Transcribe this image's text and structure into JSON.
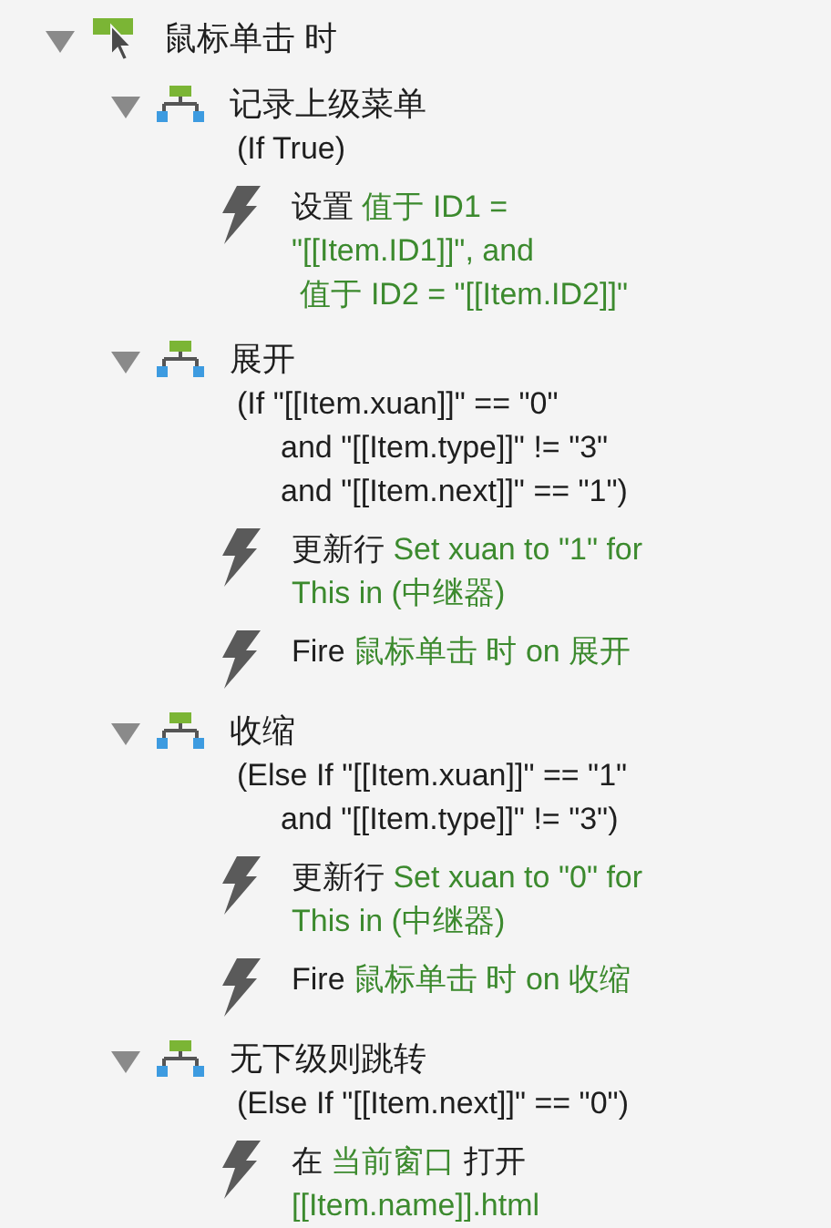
{
  "event": {
    "title": "鼠标单击 时",
    "expanded": true,
    "cases": [
      {
        "title": "记录上级菜单",
        "expanded": true,
        "condition": [
          "(If True)"
        ],
        "actions": [
          {
            "parts": [
              {
                "kind": "verb",
                "text": "设置"
              },
              {
                "kind": "target",
                "text": "值于 ID1 =\n\"[[Item.ID1]]\", and\n 值于 ID2 = \"[[Item.ID2]]\""
              }
            ]
          }
        ]
      },
      {
        "title": "展开",
        "expanded": true,
        "condition": [
          "(If \"[[Item.xuan]]\" == \"0\"",
          "and \"[[Item.type]]\" != \"3\"",
          "and \"[[Item.next]]\" == \"1\")"
        ],
        "actions": [
          {
            "parts": [
              {
                "kind": "verb",
                "text": "更新行"
              },
              {
                "kind": "target",
                "text": "Set xuan to \"1\" for\nThis in (中继器)"
              }
            ]
          },
          {
            "parts": [
              {
                "kind": "verb",
                "text": "Fire"
              },
              {
                "kind": "target",
                "text": "鼠标单击 时 on 展开"
              }
            ]
          }
        ]
      },
      {
        "title": "收缩",
        "expanded": true,
        "condition": [
          "(Else If \"[[Item.xuan]]\" == \"1\"",
          "and \"[[Item.type]]\" != \"3\")"
        ],
        "actions": [
          {
            "parts": [
              {
                "kind": "verb",
                "text": "更新行"
              },
              {
                "kind": "target",
                "text": "Set xuan to \"0\" for\nThis in (中继器)"
              }
            ]
          },
          {
            "parts": [
              {
                "kind": "verb",
                "text": "Fire"
              },
              {
                "kind": "target",
                "text": "鼠标单击 时 on 收缩"
              }
            ]
          }
        ]
      },
      {
        "title": "无下级则跳转",
        "expanded": true,
        "condition": [
          "(Else If \"[[Item.next]]\" == \"0\")"
        ],
        "actions": [
          {
            "parts": [
              {
                "kind": "verb",
                "text": "在"
              },
              {
                "kind": "target",
                "text": "当前窗口"
              },
              {
                "kind": "verb",
                "text": "打开"
              },
              {
                "kind": "target",
                "text": "\n[[Item.name]].html"
              }
            ]
          }
        ]
      }
    ]
  }
}
